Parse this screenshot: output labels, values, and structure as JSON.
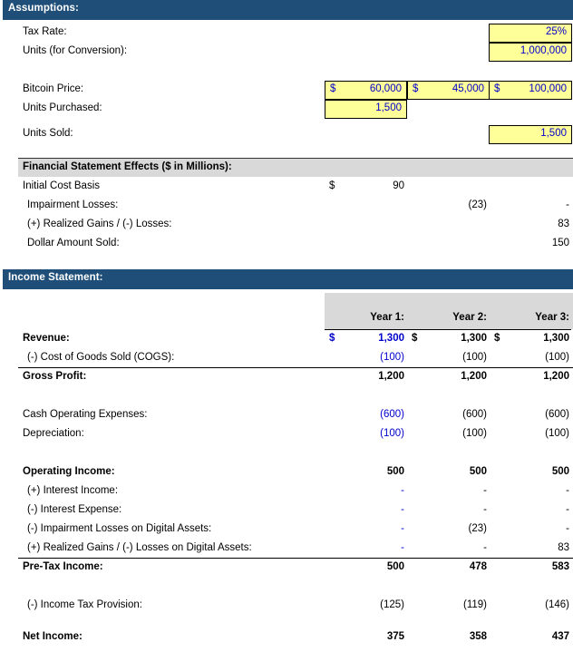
{
  "sections": {
    "assumptions": {
      "title": "Assumptions:",
      "rows": [
        {
          "label": "Tax Rate:",
          "value": "25%"
        },
        {
          "label": "Units (for Conversion):",
          "value": "1,000,000"
        },
        {
          "label": "Bitcoin Price:",
          "currency": "$",
          "v1": "60,000",
          "v2": "45,000",
          "v3": "100,000"
        },
        {
          "label": "Units Purchased:",
          "value": "1,500"
        },
        {
          "label": "Units Sold:",
          "value": "1,500"
        }
      ]
    },
    "effects": {
      "title": "Financial Statement Effects ($ in Millions):",
      "rows": [
        {
          "label": "Initial Cost Basis",
          "currency": "$",
          "v1": "90",
          "v2": "",
          "v3": ""
        },
        {
          "label": "Impairment Losses:",
          "v1": "",
          "v2": "(23)",
          "v3": "-"
        },
        {
          "label": "(+) Realized Gains / (-) Losses:",
          "v1": "",
          "v2": "",
          "v3": "83"
        },
        {
          "label": "Dollar Amount Sold:",
          "v1": "",
          "v2": "",
          "v3": "150"
        }
      ]
    },
    "income_statement": {
      "title": "Income Statement:",
      "columns": [
        "Year 1:",
        "Year 2:",
        "Year 3:"
      ],
      "rows": [
        {
          "label": "Revenue:",
          "currency": "$",
          "v1": "1,300",
          "v2": "1,300",
          "v3": "1,300"
        },
        {
          "label": "(-) Cost of Goods Sold (COGS):",
          "v1": "(100)",
          "v2": "(100)",
          "v3": "(100)"
        },
        {
          "label": "Gross Profit:",
          "v1": "1,200",
          "v2": "1,200",
          "v3": "1,200"
        },
        {
          "label": "Cash Operating Expenses:",
          "v1": "(600)",
          "v2": "(600)",
          "v3": "(600)"
        },
        {
          "label": "Depreciation:",
          "v1": "(100)",
          "v2": "(100)",
          "v3": "(100)"
        },
        {
          "label": "Operating Income:",
          "v1": "500",
          "v2": "500",
          "v3": "500"
        },
        {
          "label": "(+) Interest Income:",
          "v1": "-",
          "v2": "-",
          "v3": "-"
        },
        {
          "label": "(-) Interest Expense:",
          "v1": "-",
          "v2": "-",
          "v3": "-"
        },
        {
          "label": "(-) Impairment Losses on Digital Assets:",
          "v1": "-",
          "v2": "(23)",
          "v3": "-"
        },
        {
          "label": "(+) Realized Gains / (-) Losses on Digital Assets:",
          "v1": "-",
          "v2": "-",
          "v3": "83"
        },
        {
          "label": "Pre-Tax Income:",
          "v1": "500",
          "v2": "478",
          "v3": "583"
        },
        {
          "label": "(-) Income Tax Provision:",
          "v1": "(125)",
          "v2": "(119)",
          "v3": "(146)"
        },
        {
          "label": "Net Income:",
          "v1": "375",
          "v2": "358",
          "v3": "437"
        }
      ]
    }
  },
  "colors": {
    "header_blue": "#1f4e79",
    "subheader_grey": "#d9d9d9",
    "input_yellow": "#ffff99",
    "input_text_blue": "#0000cc"
  }
}
